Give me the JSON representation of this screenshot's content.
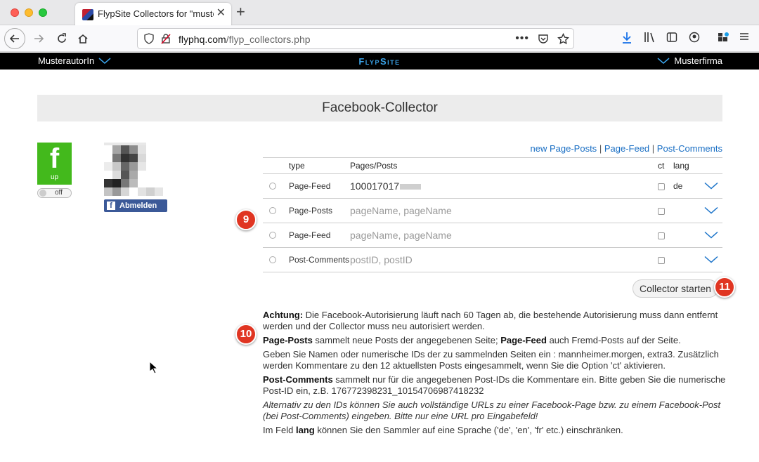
{
  "browser": {
    "tab_title": "FlypSite Collectors for \"musterf",
    "url_host": "flyphq.com",
    "url_path": "/flyp_collectors.php"
  },
  "appbar": {
    "author": "MusterautorIn",
    "brand": "FlypSite",
    "company": "Musterfirma",
    "accent_color": "#3aa2e8"
  },
  "page": {
    "title": "Facebook-Collector"
  },
  "facebook": {
    "tile_letter": "f",
    "tile_status": "up",
    "toggle_label": "off",
    "logout_label": "Abmelden",
    "tile_color": "#43b91c",
    "button_color": "#3b5998"
  },
  "links": {
    "new_page_posts": "new Page-Posts",
    "page_feed": "Page-Feed",
    "post_comments": "Post-Comments",
    "separator": "|"
  },
  "table": {
    "headers": {
      "type": "type",
      "pages": "Pages/Posts",
      "ct": "ct",
      "lang": "lang"
    },
    "rows": [
      {
        "type": "Page-Feed",
        "value": "100017017",
        "placeholder": "",
        "lang": "de"
      },
      {
        "type": "Page-Posts",
        "value": "",
        "placeholder": "pageName, pageName",
        "lang": ""
      },
      {
        "type": "Page-Feed",
        "value": "",
        "placeholder": "pageName, pageName",
        "lang": ""
      },
      {
        "type": "Post-Comments",
        "value": "",
        "placeholder": "postID, postID",
        "lang": ""
      }
    ]
  },
  "start_button": "Collector starten",
  "badges": {
    "b9": "9",
    "b10": "10",
    "b11": "11",
    "color": "#e03522"
  },
  "notes": {
    "achtung_label": "Achtung:",
    "achtung_text": " Die Facebook-Autorisierung läuft nach 60 Tagen ab, die bestehende Autorisierung muss dann entfernt werden und der Collector muss neu autorisiert werden.",
    "pp_label": "Page-Posts",
    "pp_text": " sammelt neue Posts der angegebenen Seite; ",
    "pf_label": "Page-Feed",
    "pf_text": " auch Fremd-Posts auf der Seite.",
    "names_text": "Geben Sie Namen oder numerische IDs der zu sammelnden Seiten ein : mannheimer.morgen, extra3. Zusätzlich werden Kommentare zu den 12 aktuellsten Posts eingesammelt, wenn Sie die Option 'ct' aktivieren.",
    "pc_label": "Post-Comments",
    "pc_text": " sammelt nur für die angegebenen Post-IDs die Kommentare ein. Bitte geben Sie die numerische Post-ID ein, z.B. 176772398231_10154706987418232",
    "alt_text": "Alternativ zu den IDs können Sie auch vollständige URLs zu einer Facebook-Page bzw. zu einem Facebook-Post (bei Post-Comments) eingeben. Bitte nur eine URL pro Eingabefeld!",
    "lang_pre": "Im Feld ",
    "lang_label": "lang",
    "lang_post": " können Sie den Sammler auf eine Sprache ('de', 'en', 'fr' etc.) einschränken."
  }
}
